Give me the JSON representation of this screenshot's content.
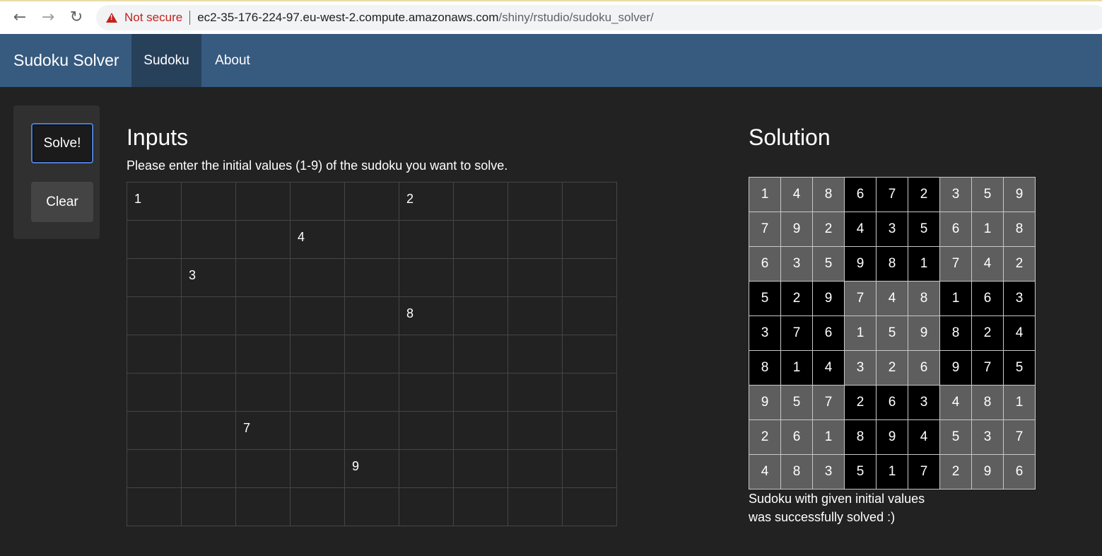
{
  "browser": {
    "security_label": "Not secure",
    "url_host": "ec2-35-176-224-97.eu-west-2.compute.amazonaws.com",
    "url_path": "/shiny/rstudio/sudoku_solver/",
    "back_icon": "←",
    "forward_icon": "→",
    "reload_icon": "↻"
  },
  "navbar": {
    "brand": "Sudoku Solver",
    "tabs": [
      {
        "label": "Sudoku",
        "active": true
      },
      {
        "label": "About",
        "active": false
      }
    ]
  },
  "sidebar": {
    "solve_label": "Solve!",
    "clear_label": "Clear"
  },
  "inputs": {
    "title": "Inputs",
    "instructions": "Please enter the initial values (1-9) of the sudoku you want to solve.",
    "grid": [
      [
        "1",
        "",
        "",
        "",
        "",
        "2",
        "",
        "",
        ""
      ],
      [
        "",
        "",
        "",
        "4",
        "",
        "",
        "",
        "",
        ""
      ],
      [
        "",
        "3",
        "",
        "",
        "",
        "",
        "",
        "",
        ""
      ],
      [
        "",
        "",
        "",
        "",
        "",
        "8",
        "",
        "",
        ""
      ],
      [
        "",
        "",
        "",
        "",
        "",
        "",
        "",
        "",
        ""
      ],
      [
        "",
        "",
        "",
        "",
        "",
        "",
        "",
        "",
        ""
      ],
      [
        "",
        "",
        "7",
        "",
        "",
        "",
        "",
        "",
        ""
      ],
      [
        "",
        "",
        "",
        "",
        "9",
        "",
        "",
        "",
        ""
      ],
      [
        "",
        "",
        "",
        "",
        "",
        "",
        "",
        "",
        ""
      ]
    ]
  },
  "solution": {
    "title": "Solution",
    "grid": [
      [
        "1",
        "4",
        "8",
        "6",
        "7",
        "2",
        "3",
        "5",
        "9"
      ],
      [
        "7",
        "9",
        "2",
        "4",
        "3",
        "5",
        "6",
        "1",
        "8"
      ],
      [
        "6",
        "3",
        "5",
        "9",
        "8",
        "1",
        "7",
        "4",
        "2"
      ],
      [
        "5",
        "2",
        "9",
        "7",
        "4",
        "8",
        "1",
        "6",
        "3"
      ],
      [
        "3",
        "7",
        "6",
        "1",
        "5",
        "9",
        "8",
        "2",
        "4"
      ],
      [
        "8",
        "1",
        "4",
        "3",
        "2",
        "6",
        "9",
        "7",
        "5"
      ],
      [
        "9",
        "5",
        "7",
        "2",
        "6",
        "3",
        "4",
        "8",
        "1"
      ],
      [
        "2",
        "6",
        "1",
        "8",
        "9",
        "4",
        "5",
        "3",
        "7"
      ],
      [
        "4",
        "8",
        "3",
        "5",
        "1",
        "7",
        "2",
        "9",
        "6"
      ]
    ],
    "message_line1": "Sudoku with given initial values",
    "message_line2": "was successfully solved :)"
  },
  "colors": {
    "navbar_bg": "#375a7f",
    "active_tab_bg": "#28415b",
    "page_bg": "#222222",
    "box_dark": "#000000",
    "box_light": "#5e5e5e",
    "warning_red": "#c5221f"
  }
}
